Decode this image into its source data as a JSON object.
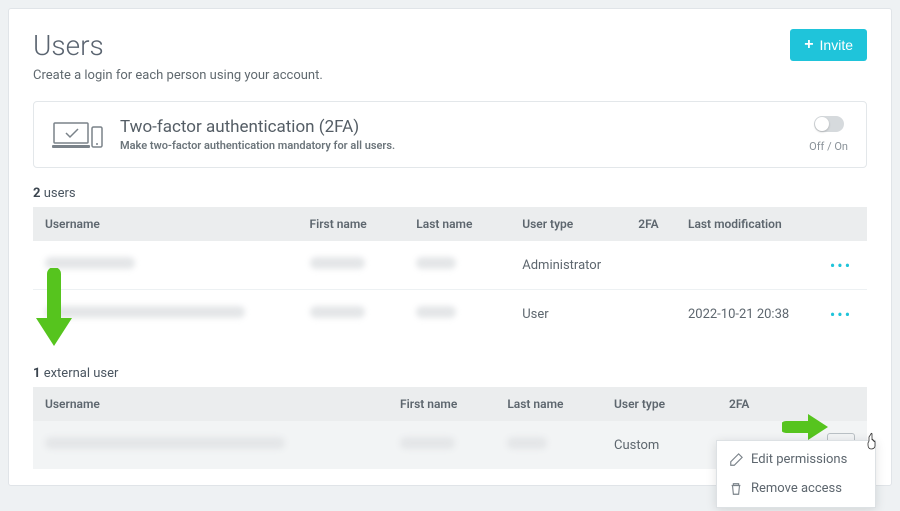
{
  "header": {
    "title": "Users",
    "invite_label": "Invite",
    "subtitle": "Create a login for each person using your account."
  },
  "twofa": {
    "title": "Two-factor authentication (2FA)",
    "subtitle": "Make two-factor authentication mandatory for all users.",
    "toggle_label": "Off / On"
  },
  "users": {
    "count": "2",
    "count_label": "users",
    "columns": {
      "username": "Username",
      "first_name": "First name",
      "last_name": "Last name",
      "user_type": "User type",
      "twofa": "2FA",
      "last_mod": "Last modification"
    },
    "rows": [
      {
        "user_type": "Administrator",
        "last_mod": ""
      },
      {
        "user_type": "User",
        "last_mod": "2022-10-21 20:38"
      }
    ]
  },
  "external": {
    "count": "1",
    "count_label": "external user",
    "columns": {
      "username": "Username",
      "first_name": "First name",
      "last_name": "Last name",
      "user_type": "User type",
      "twofa": "2FA"
    },
    "rows": [
      {
        "user_type": "Custom"
      }
    ]
  },
  "menu": {
    "edit": "Edit permissions",
    "remove": "Remove access"
  }
}
